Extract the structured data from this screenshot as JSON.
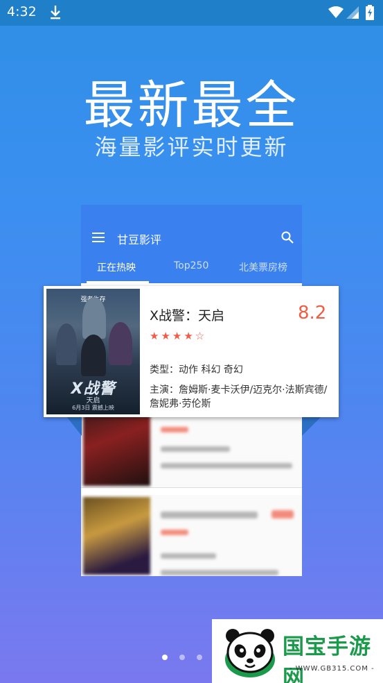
{
  "status_bar": {
    "time": "4:32",
    "icons": [
      "download-icon",
      "wifi-icon",
      "signal-icon",
      "battery-icon"
    ]
  },
  "promo": {
    "headline": "最新最全",
    "subline": "海量影评实时更新"
  },
  "app": {
    "title": "甘豆影评",
    "tabs": [
      {
        "label": "正在热映",
        "active": true
      },
      {
        "label": "Top250",
        "active": false
      },
      {
        "label": "北美票房榜",
        "active": false
      }
    ]
  },
  "featured_movie": {
    "title": "X战警：天启",
    "score": "8.2",
    "stars": "★★★★☆",
    "rating_stars": 4,
    "genre": "类型：动作 科幻 奇幻",
    "cast": "主演：詹姆斯·麦卡沃伊/迈克尔·法斯宾德/詹妮弗·劳伦斯",
    "poster": {
      "tagline": "强者生存",
      "title": "X战警",
      "subtitle": "天启",
      "release": "6月3日 震撼上映"
    }
  },
  "pager": {
    "pages": 3,
    "current": 1
  },
  "watermark": {
    "brand": "国宝手游网",
    "url": "- WWW.GB315.COM -"
  },
  "colors": {
    "status_bar": "#1f7fc8",
    "app_bar": "#3a80ee",
    "accent_red": "#f05d46",
    "brand_green": "#1a9a4a"
  }
}
